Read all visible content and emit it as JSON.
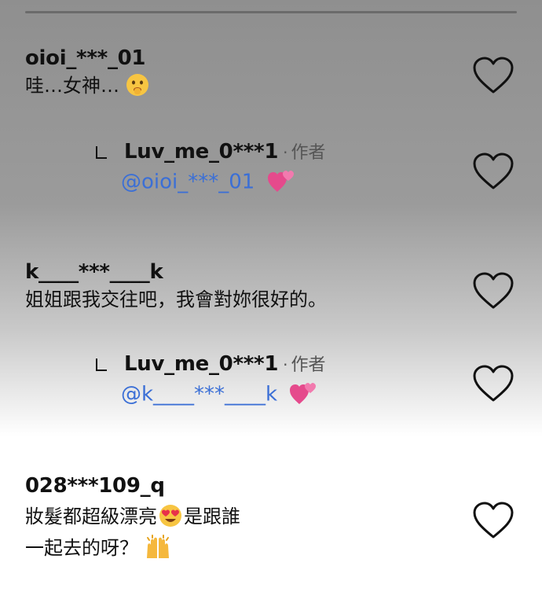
{
  "comments": [
    {
      "username": "oioi_***_01",
      "text": "哇…女神…",
      "emoji": "shushing-face",
      "reply": {
        "username": "Luv_me_0***1",
        "separator": "·",
        "author_tag": "作者",
        "mention": "@oioi_***_01",
        "emoji": "two-hearts"
      }
    },
    {
      "username": "k____***____k",
      "text": "姐姐跟我交往吧，我會對妳很好的。",
      "reply": {
        "username": "Luv_me_0***1",
        "separator": "·",
        "author_tag": "作者",
        "mention": "@k____***____k",
        "emoji": "two-hearts"
      }
    },
    {
      "username": "028***109_q",
      "text_line1": "妝髮都超級漂亮",
      "emoji_inline": "heart-eyes",
      "text_line1_end": "是跟誰",
      "text_line2": "一起去的呀？",
      "emoji_end": "raising-hands"
    }
  ],
  "colors": {
    "mention": "#3b6fd6",
    "text": "#111111",
    "muted": "#555555"
  },
  "icons": [
    "like-heart-icon",
    "reply-arrow-icon"
  ]
}
